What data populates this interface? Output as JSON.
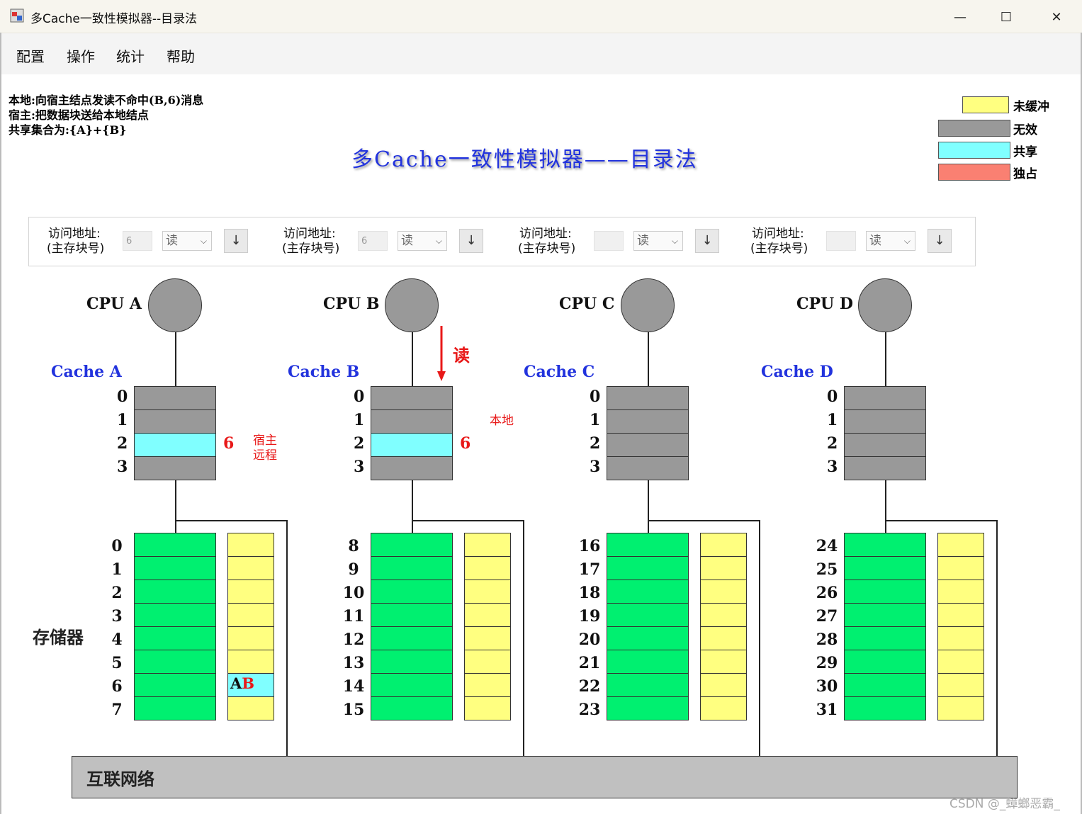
{
  "window": {
    "title": "多Cache一致性模拟器--目录法",
    "controls": {
      "minimize": "—",
      "maximize": "☐",
      "close": "✕"
    }
  },
  "menu": [
    "配置",
    "操作",
    "统计",
    "帮助"
  ],
  "messages": [
    "本地:向宿主结点发读不命中(B,6)消息",
    "宿主:把数据块送给本地结点",
    "共享集合为:{A}+{B}"
  ],
  "main_title": "多Cache一致性模拟器——目录法",
  "legend": [
    {
      "label": "未缓冲",
      "color": "#ffff80"
    },
    {
      "label": "无效",
      "color": "#999999"
    },
    {
      "label": "共享",
      "color": "#80ffff"
    },
    {
      "label": "独占",
      "color": "#fa8072"
    }
  ],
  "colors": {
    "memory": "#00f070",
    "directory": "#ffff80",
    "invalid": "#999999",
    "shared": "#80ffff",
    "accent_red": "#e81818",
    "title_blue": "#2233dd"
  },
  "controls": [
    {
      "label1": "访问地址:",
      "label2": "(主存块号)",
      "value": "6",
      "op": "读"
    },
    {
      "label1": "访问地址:",
      "label2": "(主存块号)",
      "value": "6",
      "op": "读"
    },
    {
      "label1": "访问地址:",
      "label2": "(主存块号)",
      "value": "",
      "op": "读"
    },
    {
      "label1": "访问地址:",
      "label2": "(主存块号)",
      "value": "",
      "op": "读"
    }
  ],
  "button_icon": "↓",
  "cpus": [
    {
      "cpu_label": "CPU A",
      "cache_label": "Cache A",
      "lines": [
        "0",
        "1",
        "2",
        "3"
      ],
      "line_state": [
        "invalid",
        "invalid",
        "shared",
        "invalid"
      ],
      "tag": "6",
      "note1": "宿主",
      "note2": "远程",
      "mem_blocks": [
        "0",
        "1",
        "2",
        "3",
        "4",
        "5",
        "6",
        "7"
      ],
      "dir_states": [
        "",
        "",
        "",
        "",
        "",
        "",
        "AB",
        ""
      ]
    },
    {
      "cpu_label": "CPU B",
      "cache_label": "Cache B",
      "lines": [
        "0",
        "1",
        "2",
        "3"
      ],
      "line_state": [
        "invalid",
        "invalid",
        "shared",
        "invalid"
      ],
      "tag": "6",
      "note1": "本地",
      "arrow_label": "读",
      "mem_blocks": [
        "8",
        "9",
        "10",
        "11",
        "12",
        "13",
        "14",
        "15"
      ],
      "dir_states": [
        "",
        "",
        "",
        "",
        "",
        "",
        "",
        ""
      ]
    },
    {
      "cpu_label": "CPU C",
      "cache_label": "Cache C",
      "lines": [
        "0",
        "1",
        "2",
        "3"
      ],
      "line_state": [
        "invalid",
        "invalid",
        "invalid",
        "invalid"
      ],
      "tag": "",
      "mem_blocks": [
        "16",
        "17",
        "18",
        "19",
        "20",
        "21",
        "22",
        "23"
      ],
      "dir_states": [
        "",
        "",
        "",
        "",
        "",
        "",
        "",
        ""
      ]
    },
    {
      "cpu_label": "CPU D",
      "cache_label": "Cache D",
      "lines": [
        "0",
        "1",
        "2",
        "3"
      ],
      "line_state": [
        "invalid",
        "invalid",
        "invalid",
        "invalid"
      ],
      "tag": "",
      "mem_blocks": [
        "24",
        "25",
        "26",
        "27",
        "28",
        "29",
        "30",
        "31"
      ],
      "dir_states": [
        "",
        "",
        "",
        "",
        "",
        "",
        "",
        ""
      ]
    }
  ],
  "storage_label": "存储器",
  "network_label": "互联网络",
  "watermark": "CSDN @_蟑螂恶霸_"
}
